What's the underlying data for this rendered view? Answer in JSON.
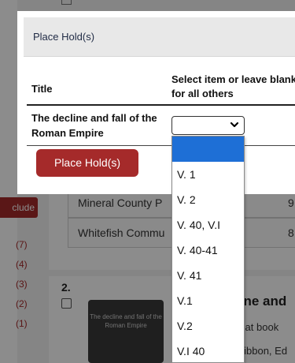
{
  "modal": {
    "title": "Place Hold(s)",
    "col_title": "Title",
    "col_select": "Select item or leave blank for all others",
    "book_title": "The decline and fall of the Roman Empire",
    "button": "Place Hold(s)",
    "select_value": ""
  },
  "dropdown": {
    "options": [
      "",
      "V. 1",
      "V. 2",
      "V. 40, V.I",
      "V. 40-41",
      "V. 41",
      "V.1",
      "V.2",
      "V.I 40"
    ],
    "selected_index": 0,
    "accent": "#1e6fd6"
  },
  "background": {
    "include_label": "clude",
    "facet_counts": [
      "(7)",
      "(4)",
      "(3)",
      "(2)",
      "(1)"
    ],
    "library_rows": [
      {
        "name": "Mineral County P",
        "count": "9"
      },
      {
        "name": "Whitefish Commu",
        "count": "8"
      }
    ],
    "result_number": "2.",
    "cover_text": "The decline and fall of the Roman Empire",
    "result_title": "line and",
    "result_subtitle": "reat book",
    "result_author": "Gibbon, Ed"
  },
  "colors": {
    "brand": "#a52a2a",
    "header_bg": "#e8e8e8"
  }
}
